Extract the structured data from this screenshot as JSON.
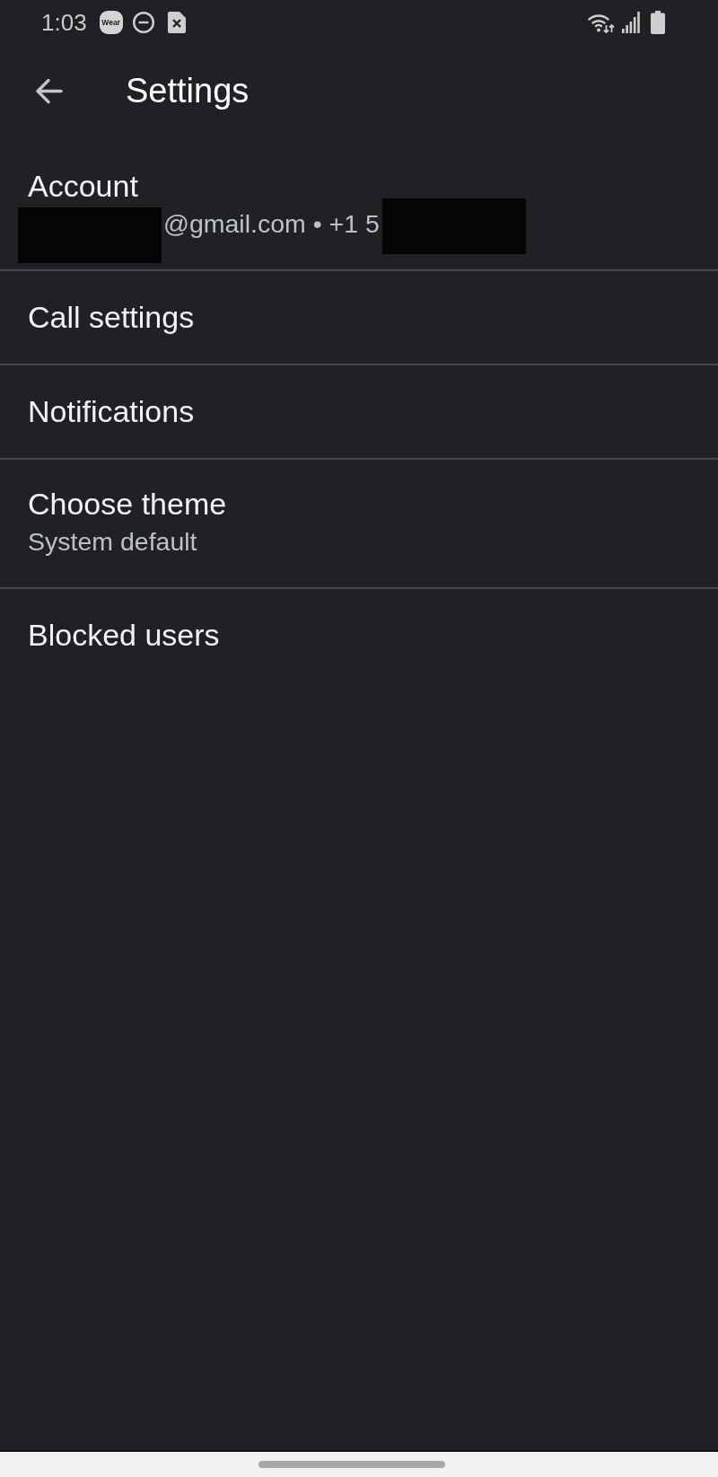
{
  "status_bar": {
    "time": "1:03",
    "badge": "Wear"
  },
  "app_bar": {
    "title": "Settings"
  },
  "settings": [
    {
      "title": "Account",
      "summary_parts": [
        {
          "kind": "redaction"
        },
        {
          "kind": "text",
          "text": "@gmail.com • +1 5"
        },
        {
          "kind": "redaction"
        }
      ]
    },
    {
      "title": "Call settings"
    },
    {
      "title": "Notifications"
    },
    {
      "title": "Choose theme",
      "summary_parts": [
        {
          "kind": "text",
          "text": "System default"
        }
      ]
    },
    {
      "title": "Blocked users"
    }
  ]
}
